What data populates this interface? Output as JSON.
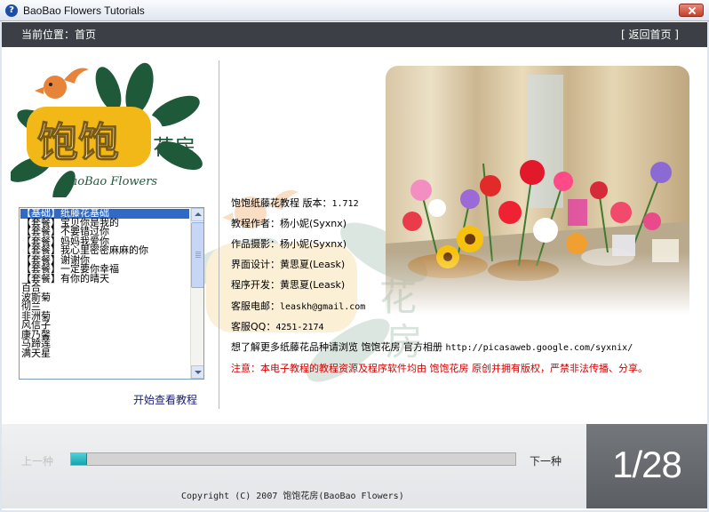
{
  "window": {
    "title": "BaoBao Flowers Tutorials",
    "icon": "help-icon"
  },
  "nav": {
    "location": "当前位置：首页",
    "home_link": "[ 返回首页 ]"
  },
  "logo": {
    "text_cn": "饱饱",
    "text_flower": "花房",
    "text_en": "BaoBao Flowers"
  },
  "list": {
    "items": [
      "【基础】纸藤花基础",
      "【套餐】宝贝你是我的",
      "【套餐】不要错过你",
      "【套餐】妈妈我爱你",
      "【套餐】我心里密密麻麻的你",
      "【套餐】谢谢你",
      "【套餐】一定要你幸福",
      "【套餐】有你的晴天",
      "百合",
      "波斯菊",
      "彻兰",
      "非洲菊",
      "风信子",
      "康乃馨",
      "马蹄莲",
      "满天星"
    ],
    "selected_index": 0,
    "start_label": "开始查看教程"
  },
  "info": {
    "product": "饱饱纸藤花教程  版本：",
    "version": "1.712",
    "author_label": "教程作者：",
    "author": "杨小妮(Syxnx)",
    "photo_label": "作品摄影：",
    "photographer": "杨小妮(Syxnx)",
    "ui_label": "界面设计：",
    "ui_designer": "黄思夏(Leask)",
    "dev_label": "程序开发：",
    "developer": "黄思夏(Leask)",
    "email_label": "客服电邮：",
    "email": "leaskh@gmail.com",
    "qq_label": "客服QQ：",
    "qq": "4251-2174",
    "more_text": "想了解更多纸藤花品种请浏览 饱饱花房 官方相册",
    "more_url": "http://picasaweb.google.com/syxnix/",
    "notice": "注意：本电子教程的教程资源及程序软件均由 饱饱花房 原创并拥有版权，严禁非法传播、分享。"
  },
  "footer": {
    "prev_label": "上一种",
    "next_label": "下一种",
    "progress_fraction": 0.0357,
    "copyright": "Copyright (C) 2007 饱饱花房(BaoBao Flowers)",
    "page_counter": "1/28"
  },
  "colors": {
    "navbar": "#3c4046",
    "accent": "#16a4ad",
    "notice": "#d40000",
    "logo_yellow": "#f2b817",
    "logo_green": "#1e5a3a"
  }
}
